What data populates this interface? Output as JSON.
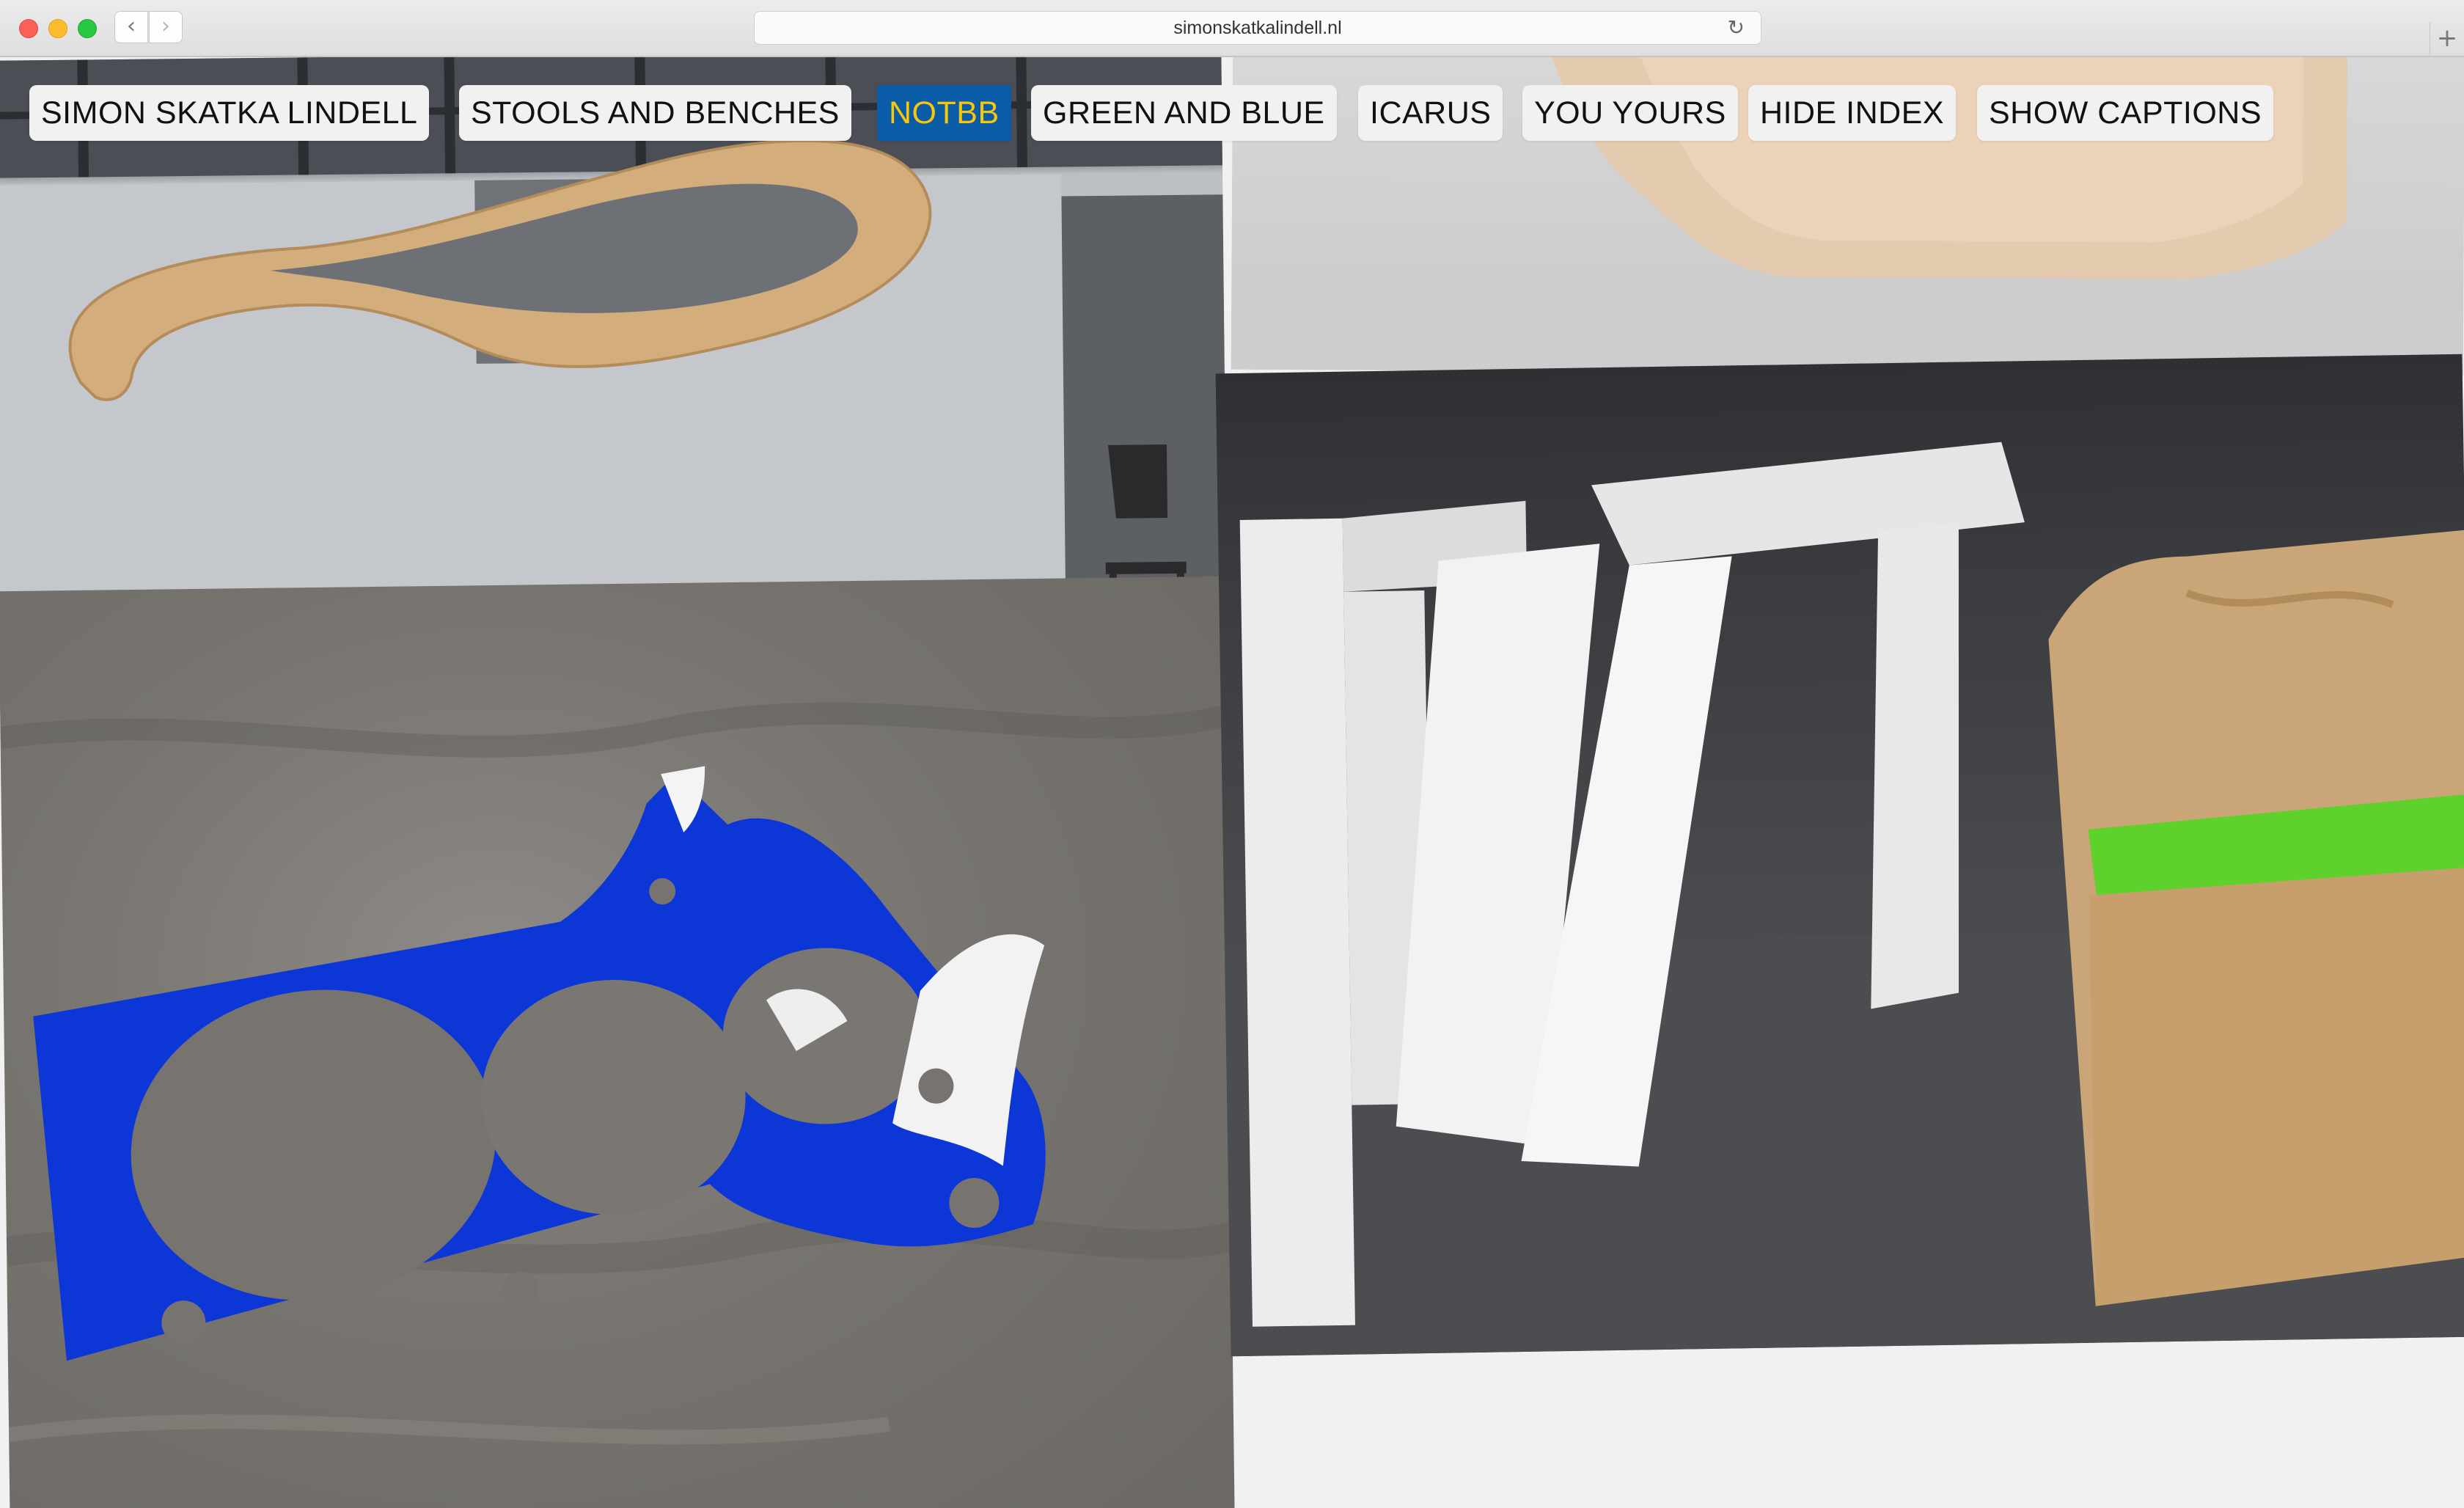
{
  "browser": {
    "url": "simonskatkalindell.nl",
    "back_glyph": "‹",
    "forward_glyph": "›",
    "reload_glyph": "↻",
    "newtab_glyph": "+"
  },
  "index": {
    "items": [
      {
        "label": "SIMON SKATKA LINDELL"
      },
      {
        "label": "STOOLS AND BENCHES"
      },
      {
        "label": "NOTBB",
        "active": true
      },
      {
        "label": "GREEN AND BLUE"
      },
      {
        "label": "ICARUS"
      },
      {
        "label": "YOU YOURS"
      },
      {
        "label": "HIDE INDEX"
      },
      {
        "label": "SHOW CAPTIONS"
      }
    ]
  },
  "colors": {
    "active_bg": "#0a5ca6",
    "active_text": "#f7c70c",
    "nav_bg": "#f1f1f1",
    "page_bg": "#f1f1f1"
  },
  "icons": [
    "close-window-icon",
    "minimize-window-icon",
    "zoom-window-icon",
    "back-icon",
    "forward-icon",
    "reload-icon",
    "new-tab-icon"
  ]
}
